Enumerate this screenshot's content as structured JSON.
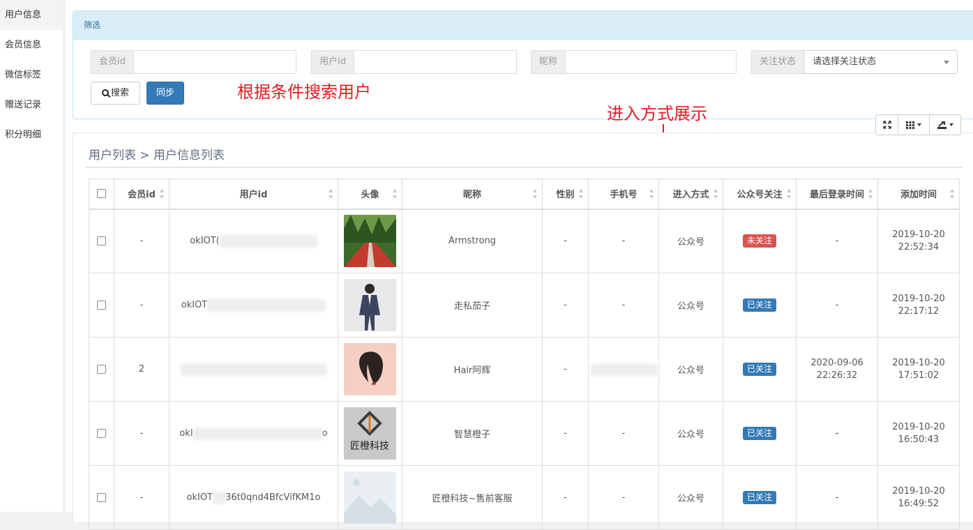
{
  "sidebar": {
    "items": [
      {
        "label": "用户信息"
      },
      {
        "label": "会员信息"
      },
      {
        "label": "微信标签"
      },
      {
        "label": "赠送记录"
      },
      {
        "label": "积分明细"
      }
    ]
  },
  "filter": {
    "heading": "筛选",
    "member_id_label": "会员id",
    "user_id_label": "用户id",
    "nickname_label": "昵称",
    "follow_label": "关注状态",
    "follow_placeholder": "请选择关注状态",
    "search_button": "搜索",
    "sync_button": "同步"
  },
  "annotations": {
    "search_note": "根据条件搜索用户",
    "entry_note": "进入方式展示"
  },
  "panel": {
    "breadcrumb": "用户列表 > 用户信息列表"
  },
  "table": {
    "headers": [
      "会员id",
      "用户id",
      "头像",
      "昵称",
      "性别",
      "手机号",
      "进入方式",
      "公众号关注",
      "最后登录时间",
      "添加时间"
    ],
    "rows": [
      {
        "member_id": "-",
        "user_id_prefix": "okIOT(",
        "user_id_suffix": "",
        "nickname": "Armstrong",
        "gender": "-",
        "phone": "-",
        "entry": "公众号",
        "follow": "未关注",
        "last_login_date": "-",
        "last_login_time": "",
        "added_date": "2019-10-20",
        "added_time": "22:52:34"
      },
      {
        "member_id": "-",
        "user_id_prefix": "okIOT",
        "user_id_suffix": "",
        "nickname": "走私茄子",
        "gender": "-",
        "phone": "-",
        "entry": "公众号",
        "follow": "已关注",
        "last_login_date": "-",
        "last_login_time": "",
        "added_date": "2019-10-20",
        "added_time": "22:17:12"
      },
      {
        "member_id": "2",
        "user_id_prefix": "",
        "user_id_suffix": "",
        "nickname": "Hair阿辉",
        "gender": "-",
        "phone": "",
        "entry": "公众号",
        "follow": "已关注",
        "last_login_date": "2020-09-06",
        "last_login_time": "22:26:32",
        "added_date": "2019-10-20",
        "added_time": "17:51:02"
      },
      {
        "member_id": "-",
        "user_id_prefix": "okI",
        "user_id_suffix": "o",
        "nickname": "智慧橙子",
        "gender": "-",
        "phone": "-",
        "entry": "公众号",
        "follow": "已关注",
        "last_login_date": "-",
        "last_login_time": "",
        "added_date": "2019-10-20",
        "added_time": "16:50:43"
      },
      {
        "member_id": "-",
        "user_id_prefix": "okIOT",
        "user_id_suffix": "36t0qnd4BfcVifKM1o",
        "nickname": "匠橙科技~售前客服",
        "gender": "-",
        "phone": "-",
        "entry": "公众号",
        "follow": "已关注",
        "last_login_date": "-",
        "last_login_time": "",
        "added_date": "2019-10-20",
        "added_time": "16:49:52"
      }
    ]
  },
  "avatars": [
    "bamboo-path-photo",
    "man-in-suit-photo",
    "hair-salon-logo",
    "jiangcheng-tech-logo",
    "placeholder-image"
  ],
  "logo_text": "匠橙科技",
  "colors": {
    "primary": "#337ab7",
    "danger": "#d9534f",
    "annotation": "#e31b23",
    "panel_head": "#d9edf7"
  }
}
